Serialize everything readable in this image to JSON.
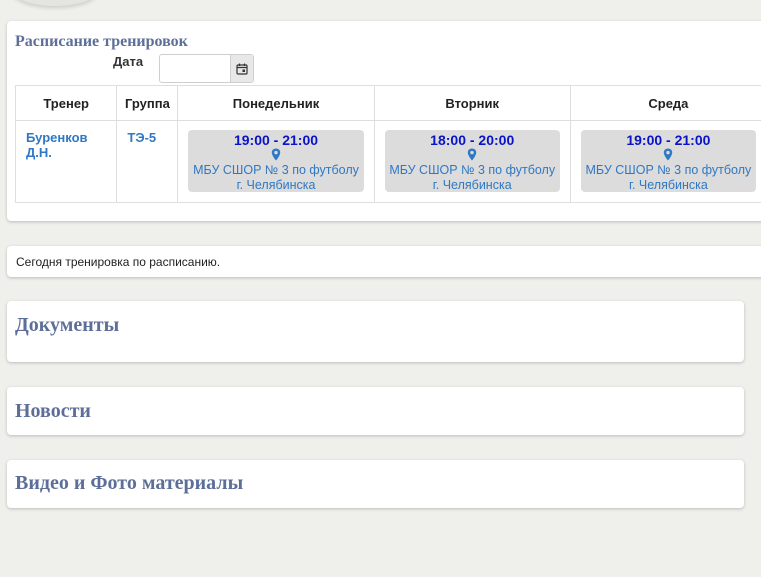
{
  "schedule": {
    "title": "Расписание тренировок",
    "date_label": "Дата",
    "date_value": "",
    "headers": [
      "Тренер",
      "Группа",
      "Понедельник",
      "Вторник",
      "Среда"
    ],
    "row": {
      "coach": "Буренков Д.Н.",
      "group": "ТЭ-5",
      "slots": [
        {
          "time": "19:00 - 21:00",
          "place_line1": "МБУ СШОР № 3 по футболу",
          "place_line2": "г. Челябинска"
        },
        {
          "time": "18:00 - 20:00",
          "place_line1": "МБУ СШОР № 3 по футболу",
          "place_line2": "г. Челябинска"
        },
        {
          "time": "19:00 - 21:00",
          "place_line1": "МБУ СШОР № 3 по футболу",
          "place_line2": "г. Челябинска"
        }
      ]
    }
  },
  "notice": {
    "text": "Сегодня тренировка по расписанию."
  },
  "sections": {
    "documents": "Документы",
    "news": "Новости",
    "media": "Видео и Фото материалы"
  },
  "colors": {
    "accent_title": "#5d6f98",
    "link_blue": "#2f78c4",
    "time_blue": "#0a13c8",
    "slot_bg": "#dcdcdc",
    "page_bg": "#eff0ec"
  },
  "icons": {
    "date_button": "calendar-icon",
    "slot_location": "map-pin-icon"
  }
}
